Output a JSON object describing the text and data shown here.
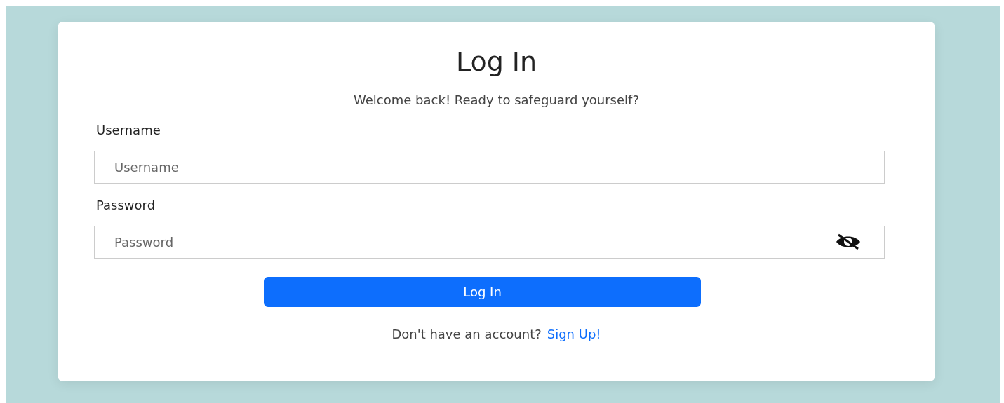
{
  "card": {
    "title": "Log In",
    "subtitle": "Welcome back! Ready to safeguard yourself?",
    "fields": [
      {
        "kind": "text",
        "label": "Username",
        "placeholder": "Username"
      },
      {
        "kind": "password",
        "label": "Password",
        "placeholder": "Password"
      }
    ],
    "button": "Log In",
    "footer": {
      "text": "Don't have an account?",
      "link": "Sign Up!"
    }
  }
}
